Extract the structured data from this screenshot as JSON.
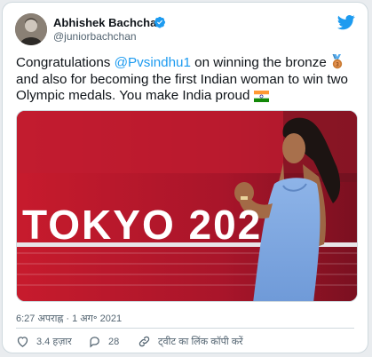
{
  "author": {
    "name": "Abhishek Bachchan",
    "handle": "@juniorbachchan",
    "verified_icon": "verified-badge-icon",
    "platform_icon": "twitter-bird-icon"
  },
  "tweet": {
    "text_part1": "Congratulations ",
    "mention": "@Pvsindhu1",
    "text_part2": " on winning the bronze",
    "text_part3": " and also for becoming the first Indian woman to win two Olympic medals. You make India proud ",
    "emoji_medal": "bronze-medal-emoji",
    "emoji_flag": "india-flag-emoji"
  },
  "media": {
    "banner_text": "TOKYO 202",
    "description_icon": "photo"
  },
  "timestamp": "6:27 अपराह्न · 1 अग॰ 2021",
  "actions": {
    "likes": "3.4 हज़ार",
    "replies": "28",
    "copy_link": "ट्वीट का लिंक कॉपी करें"
  },
  "colors": {
    "accent": "#1d9bf0",
    "text": "#0f1419",
    "muted": "#536471",
    "border": "#cfd9de",
    "banner_red": "#b8182a"
  }
}
